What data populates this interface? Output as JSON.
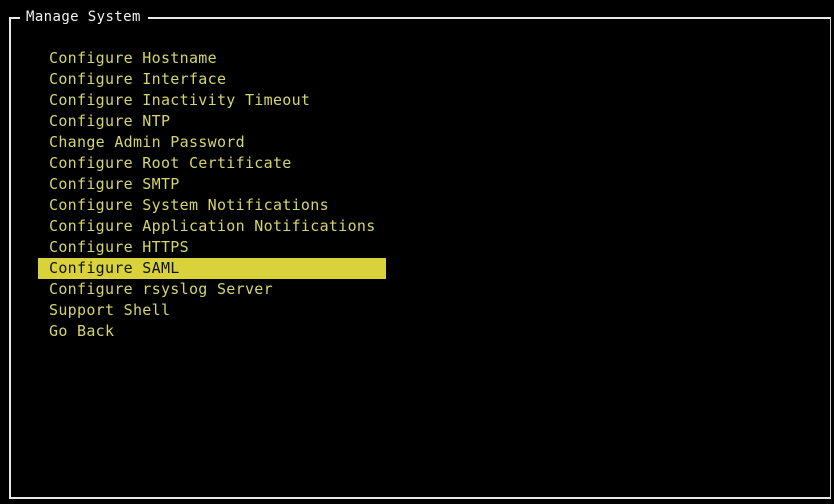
{
  "window": {
    "title": "Manage System"
  },
  "menu": {
    "selected_index": 10,
    "items": [
      {
        "label": "Configure Hostname"
      },
      {
        "label": "Configure Interface"
      },
      {
        "label": "Configure Inactivity Timeout"
      },
      {
        "label": "Configure NTP"
      },
      {
        "label": "Change Admin Password"
      },
      {
        "label": "Configure Root Certificate"
      },
      {
        "label": "Configure SMTP"
      },
      {
        "label": "Configure System Notifications"
      },
      {
        "label": "Configure Application Notifications"
      },
      {
        "label": "Configure HTTPS"
      },
      {
        "label": "Configure SAML"
      },
      {
        "label": "Configure rsyslog Server"
      },
      {
        "label": "Support Shell"
      },
      {
        "label": "Go Back"
      }
    ]
  },
  "colors": {
    "background": "#000000",
    "menu_text": "#d6d46c",
    "highlight_bg": "#d9d23a",
    "highlight_text": "#111111",
    "frame": "#e8e8e8"
  }
}
